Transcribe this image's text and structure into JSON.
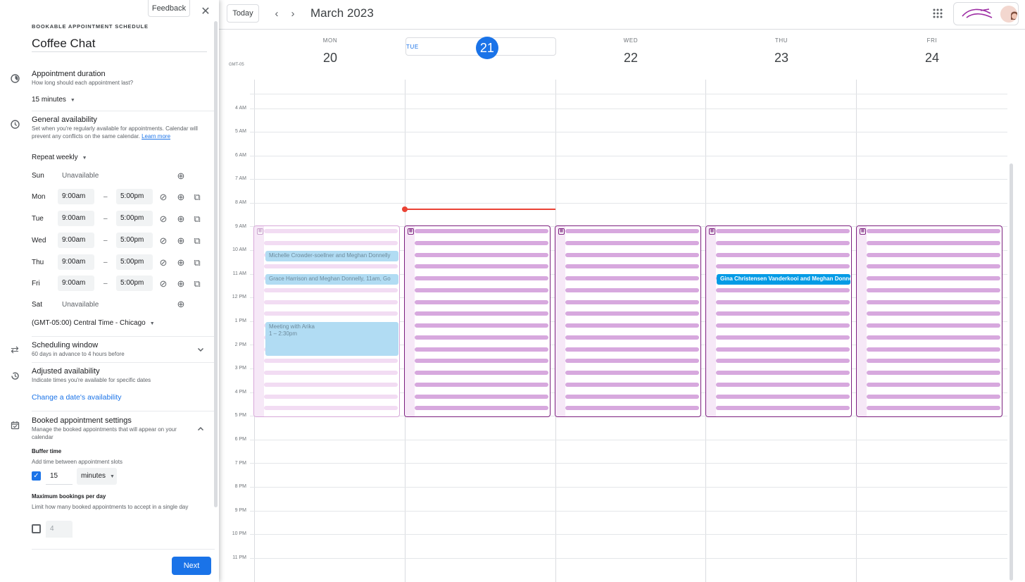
{
  "panel": {
    "feedback_label": "Feedback",
    "eyebrow": "BOOKABLE APPOINTMENT SCHEDULE",
    "title": "Coffee Chat",
    "duration": {
      "title": "Appointment duration",
      "subtitle": "How long should each appointment last?",
      "value": "15 minutes"
    },
    "availability": {
      "title": "General availability",
      "subtitle": "Set when you're regularly available for appointments. Calendar will prevent any conflicts on the same calendar.",
      "learn_more": "Learn more",
      "repeat": "Repeat weekly",
      "days": [
        {
          "day": "Sun",
          "unavailable": "Unavailable"
        },
        {
          "day": "Mon",
          "start": "9:00am",
          "sep": "–",
          "end": "5:00pm"
        },
        {
          "day": "Tue",
          "start": "9:00am",
          "sep": "–",
          "end": "5:00pm"
        },
        {
          "day": "Wed",
          "start": "9:00am",
          "sep": "–",
          "end": "5:00pm"
        },
        {
          "day": "Thu",
          "start": "9:00am",
          "sep": "–",
          "end": "5:00pm"
        },
        {
          "day": "Fri",
          "start": "9:00am",
          "sep": "–",
          "end": "5:00pm"
        },
        {
          "day": "Sat",
          "unavailable": "Unavailable"
        }
      ],
      "timezone": "(GMT-05:00) Central Time - Chicago"
    },
    "scheduling": {
      "title": "Scheduling window",
      "subtitle": "60 days in advance to 4 hours before"
    },
    "adjusted": {
      "title": "Adjusted availability",
      "subtitle": "Indicate times you're available for specific dates",
      "link": "Change a date's availability"
    },
    "booked": {
      "title": "Booked appointment settings",
      "subtitle": "Manage the booked appointments that will appear on your calendar",
      "buffer_title": "Buffer time",
      "buffer_sub": "Add time between appointment slots",
      "buffer_checked": true,
      "buffer_value": "15",
      "buffer_unit": "minutes",
      "max_title": "Maximum bookings per day",
      "max_sub": "Limit how many booked appointments to accept in a single day",
      "max_checked": false,
      "max_value": "4"
    },
    "next_label": "Next"
  },
  "topbar": {
    "today_label": "Today",
    "month_title": "March 2023",
    "apps_icon": "grid-icon"
  },
  "calendar": {
    "timezone_label": "GMT-05",
    "days": [
      {
        "dow": "MON",
        "num": "20",
        "today": false
      },
      {
        "dow": "TUE",
        "num": "21",
        "today": true
      },
      {
        "dow": "WED",
        "num": "22",
        "today": false
      },
      {
        "dow": "THU",
        "num": "23",
        "today": false
      },
      {
        "dow": "FRI",
        "num": "24",
        "today": false
      }
    ],
    "hours": [
      "4 AM",
      "5 AM",
      "6 AM",
      "7 AM",
      "8 AM",
      "9 AM",
      "10 AM",
      "11 AM",
      "12 PM",
      "1 PM",
      "2 PM",
      "3 PM",
      "4 PM",
      "5 PM",
      "6 PM",
      "7 PM",
      "8 PM",
      "9 PM",
      "10 PM",
      "11 PM"
    ],
    "events": {
      "ev1": {
        "title": "Michelle Crowder-soellner and Meghan Donnelly"
      },
      "ev2": {
        "title": "Grace Harrison and Meghan Donnelly",
        "tail": ", 11am, Go"
      },
      "ev3": {
        "title": "Meeting with Arika",
        "time": "1 – 2:30pm"
      },
      "ev4": {
        "title": "Gina Christensen Vanderkooi and Meghan Donnelly"
      }
    },
    "colors": {
      "accent": "#1a73e8",
      "slot_border": "#7b1f7e",
      "slot_strip": "#d7a8de",
      "now_line": "#ea4335",
      "event_active": "#039be5"
    }
  }
}
